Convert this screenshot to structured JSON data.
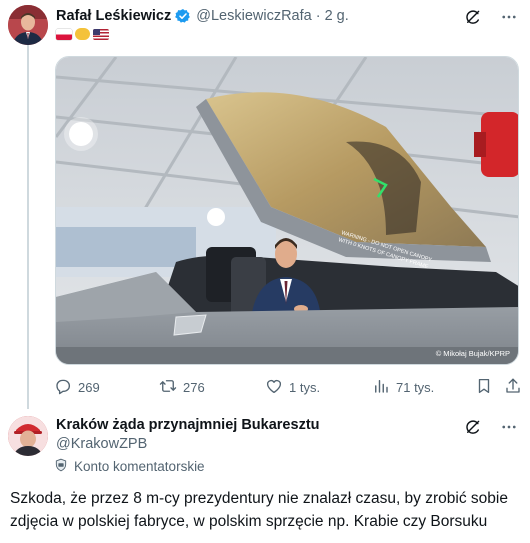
{
  "tweet1": {
    "author_name": "Rafał Leśkiewicz",
    "handle": "@LeskiewiczRafa",
    "separator": "·",
    "time": "2 g.",
    "photo_credit": "© Mikołaj Bujak/KPRP",
    "canopy_text_1": "WARNING - DO NOT OPEN CANOPY",
    "canopy_text_2": "WITH 0 KNOTS OF CANOPY FRAME",
    "stats": {
      "replies": "269",
      "reposts": "276",
      "likes": "1 tys.",
      "views": "71 tys."
    }
  },
  "tweet2": {
    "author_name": "Kraków żąda przynajmniej Bukaresztu",
    "handle": "@KrakowZPB",
    "commentator_label": "Konto komentatorskie",
    "text": "Szkoda, że przez 8 m-cy prezydentury nie znalazł czasu, by zrobić sobie zdjęcia w polskiej fabryce, w polskim sprzęcie np. Krabie czy Borsuku"
  },
  "icons": {
    "verified": "verified-badge-icon",
    "grok": "grok-icon",
    "more": "more-icon",
    "reply": "reply-icon",
    "repost": "repost-icon",
    "like": "heart-icon",
    "views": "views-icon",
    "bookmark": "bookmark-icon",
    "share": "share-icon",
    "commentator": "commentator-badge-icon"
  },
  "colors": {
    "verified_blue": "#1d9bf0",
    "secondary_text": "#536471",
    "primary_text": "#0f1419",
    "thread_line": "#cfd9de"
  }
}
